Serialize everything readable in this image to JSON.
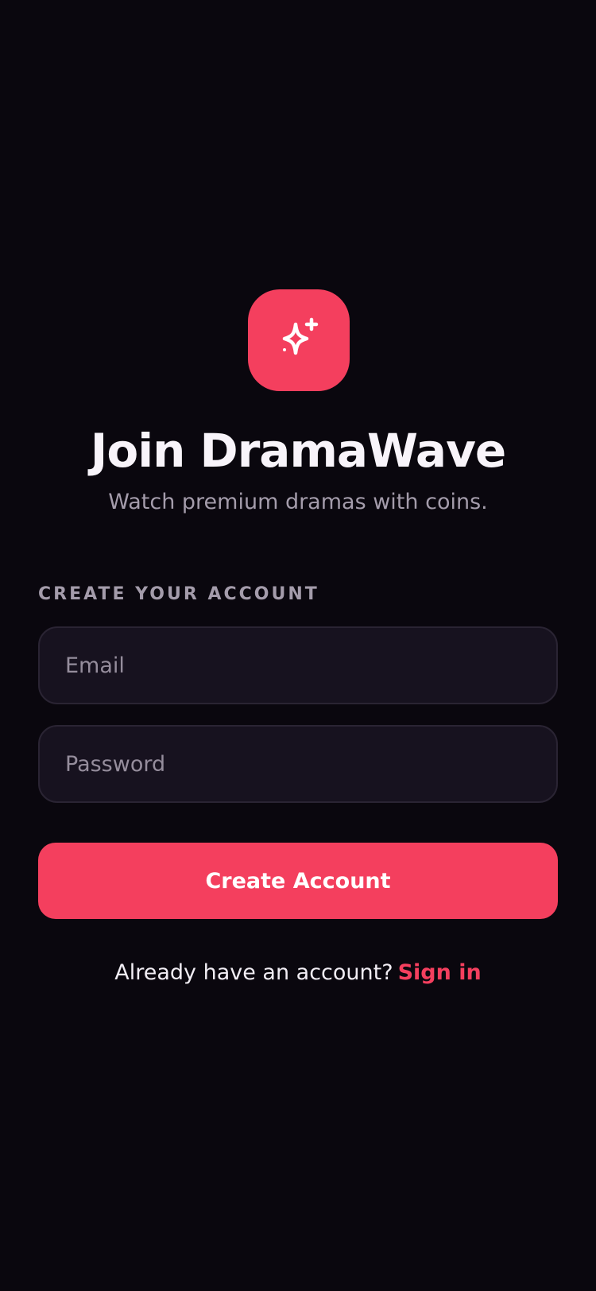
{
  "app": {
    "title": "Join DramaWave",
    "subtitle": "Watch premium dramas with coins.",
    "logo_icon": "sparkles-icon",
    "accent_color": "#f43f5e"
  },
  "form": {
    "section_label": "CREATE YOUR ACCOUNT",
    "email": {
      "value": "",
      "placeholder": "Email"
    },
    "password": {
      "value": "",
      "placeholder": "Password"
    },
    "submit_label": "Create Account"
  },
  "footer": {
    "prompt": "Already have an account?",
    "link_label": "Sign in"
  }
}
